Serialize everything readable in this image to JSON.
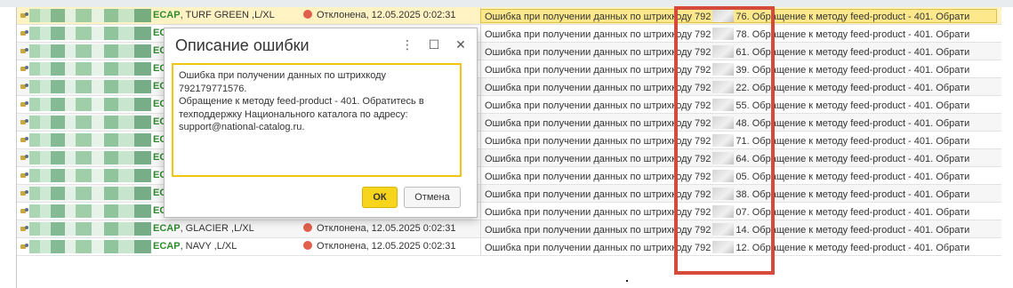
{
  "rows": [
    {
      "product_prefix": "ECAP",
      "product_rest": ", TURF GREEN ,L/XL",
      "status": "Отклонена, 12.05.2025 0:02:31",
      "err_a": "Ошибка при получении данных по штрихкоду 792",
      "err_b": "76. Обращение к методу feed-product - 401. Обрати",
      "selected": true
    },
    {
      "product_prefix": "EC",
      "product_rest": "",
      "status": "",
      "err_a": "Ошибка при получении данных по штрихкоду 792",
      "err_b": "78. Обращение к методу feed-product - 401. Обрати"
    },
    {
      "product_prefix": "EC",
      "product_rest": "",
      "status": "",
      "err_a": "Ошибка при получении данных по штрихкоду 792",
      "err_b": "61. Обращение к методу feed-product - 401. Обрати"
    },
    {
      "product_prefix": "EC",
      "product_rest": "",
      "status": "",
      "err_a": "Ошибка при получении данных по штрихкоду 792",
      "err_b": "39. Обращение к методу feed-product - 401. Обрати"
    },
    {
      "product_prefix": "EC",
      "product_rest": "",
      "status": "",
      "err_a": "Ошибка при получении данных по штрихкоду 792",
      "err_b": "22. Обращение к методу feed-product - 401. Обрати"
    },
    {
      "product_prefix": "EC",
      "product_rest": "",
      "status": "",
      "err_a": "Ошибка при получении данных по штрихкоду 792",
      "err_b": "55. Обращение к методу feed-product - 401. Обрати"
    },
    {
      "product_prefix": "EC",
      "product_rest": "",
      "status": "",
      "err_a": "Ошибка при получении данных по штрихкоду 792",
      "err_b": "48. Обращение к методу feed-product - 401. Обрати"
    },
    {
      "product_prefix": "EC",
      "product_rest": "",
      "status": "",
      "err_a": "Ошибка при получении данных по штрихкоду 792",
      "err_b": "71. Обращение к методу feed-product - 401. Обрати"
    },
    {
      "product_prefix": "EC",
      "product_rest": "",
      "status": "",
      "err_a": "Ошибка при получении данных по штрихкоду 792",
      "err_b": "64. Обращение к методу feed-product - 401. Обрати"
    },
    {
      "product_prefix": "EC",
      "product_rest": "",
      "status": "",
      "err_a": "Ошибка при получении данных по штрихкоду 792",
      "err_b": "05. Обращение к методу feed-product - 401. Обрати"
    },
    {
      "product_prefix": "EC",
      "product_rest": "",
      "status": "",
      "err_a": "Ошибка при получении данных по штрихкоду 792",
      "err_b": "38. Обращение к методу feed-product - 401. Обрати"
    },
    {
      "product_prefix": "EC",
      "product_rest": "",
      "status": "",
      "err_a": "Ошибка при получении данных по штрихкоду 792",
      "err_b": "07. Обращение к методу feed-product - 401. Обрати"
    },
    {
      "product_prefix": "ECAP",
      "product_rest": ", GLACIER ,L/XL",
      "status": "Отклонена, 12.05.2025 0:02:31",
      "err_a": "Ошибка при получении данных по штрихкоду 792",
      "err_b": "14. Обращение к методу feed-product - 401. Обрати"
    },
    {
      "product_prefix": "ECAP",
      "product_rest": ", NAVY ,L/XL",
      "status": "Отклонена, 12.05.2025 0:02:31",
      "err_a": "Ошибка при получении данных по штрихкоду 792",
      "err_b": "12. Обращение к методу feed-product - 401. Обрати"
    }
  ],
  "dialog": {
    "title": "Описание ошибки",
    "menu_icon": "more-vertical-icon",
    "maximize_icon": "maximize-icon",
    "close_icon": "close-icon",
    "message": "Ошибка при получении данных по штрихкоду 792179771576.\nОбращение к методу feed-product - 401. Обратитесь в\nтехподдержку Национального каталога по адресу:\nsupport@national-catalog.ru.",
    "ok_label": "ОК",
    "cancel_label": "Отмена"
  },
  "colors": {
    "accent": "#f7d51d",
    "highlight": "#d64a3c",
    "status_rejected": "#e0604c",
    "selected_row": "#fde98c"
  }
}
